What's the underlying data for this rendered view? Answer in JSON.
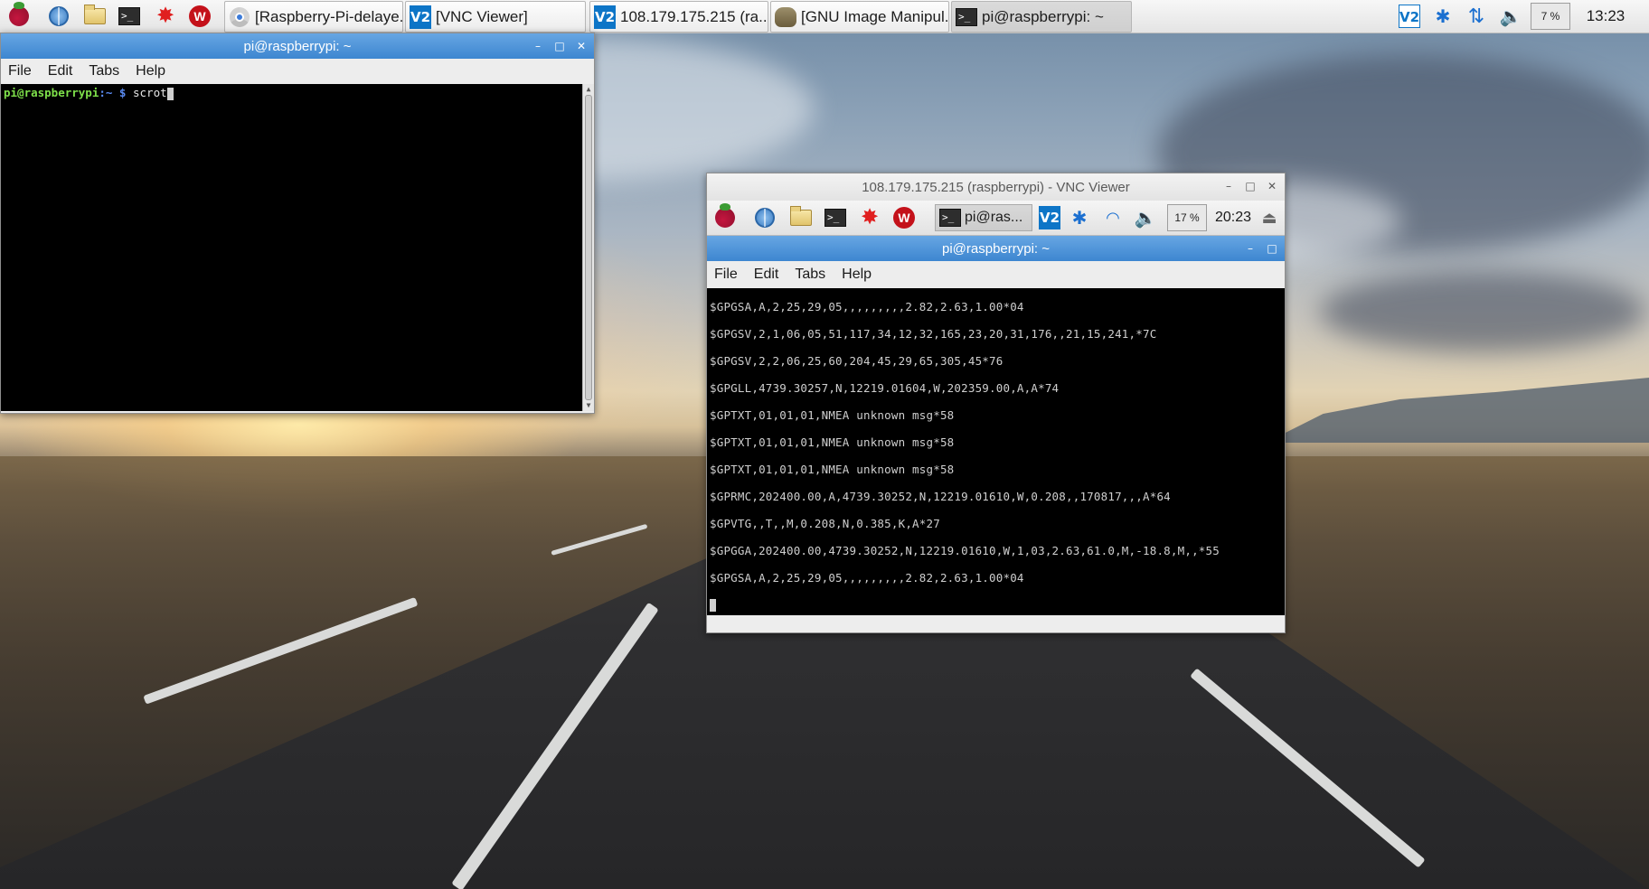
{
  "taskbar": {
    "launchers": [
      {
        "name": "raspberry-menu-icon"
      },
      {
        "name": "web-browser-icon"
      },
      {
        "name": "file-manager-icon"
      },
      {
        "name": "terminal-icon"
      },
      {
        "name": "mathematica-icon"
      },
      {
        "name": "wolfram-icon"
      }
    ],
    "tasks": [
      {
        "label": "[Raspberry-Pi-delaye...",
        "icon": "chromium-icon"
      },
      {
        "label": "[VNC Viewer]",
        "icon": "vnc-icon"
      },
      {
        "label": "108.179.175.215 (ra...",
        "icon": "vnc-icon"
      },
      {
        "label": "[GNU Image Manipul...",
        "icon": "gimp-icon"
      },
      {
        "label": "pi@raspberrypi: ~",
        "icon": "terminal-icon"
      }
    ],
    "cpu_usage": "7 %",
    "clock": "13:23"
  },
  "local_terminal": {
    "title": "pi@raspberrypi: ~",
    "menu": [
      "File",
      "Edit",
      "Tabs",
      "Help"
    ],
    "prompt_user": "pi@raspberrypi",
    "prompt_path": ":~ $",
    "command": "scrot"
  },
  "vnc_window": {
    "title": "108.179.175.215 (raspberrypi) - VNC Viewer",
    "remote_panel": {
      "task_label": "pi@ras...",
      "cpu_usage": "17 %",
      "clock": "20:23"
    },
    "remote_terminal": {
      "title": "pi@raspberrypi: ~",
      "menu": [
        "File",
        "Edit",
        "Tabs",
        "Help"
      ],
      "lines": [
        "$GPGSA,A,2,25,29,05,,,,,,,,,2.82,2.63,1.00*04",
        "$GPGSV,2,1,06,05,51,117,34,12,32,165,23,20,31,176,,21,15,241,*7C",
        "$GPGSV,2,2,06,25,60,204,45,29,65,305,45*76",
        "$GPGLL,4739.30257,N,12219.01604,W,202359.00,A,A*74",
        "$GPTXT,01,01,01,NMEA unknown msg*58",
        "$GPTXT,01,01,01,NMEA unknown msg*58",
        "$GPTXT,01,01,01,NMEA unknown msg*58",
        "$GPRMC,202400.00,A,4739.30252,N,12219.01610,W,0.208,,170817,,,A*64",
        "$GPVTG,,T,,M,0.208,N,0.385,K,A*27",
        "$GPGGA,202400.00,4739.30252,N,12219.01610,W,1,03,2.63,61.0,M,-18.8,M,,*55",
        "$GPGSA,A,2,25,29,05,,,,,,,,,2.82,2.63,1.00*04"
      ]
    }
  },
  "window_controls": {
    "minimize": "–",
    "maximize": "□",
    "close": "✕"
  }
}
